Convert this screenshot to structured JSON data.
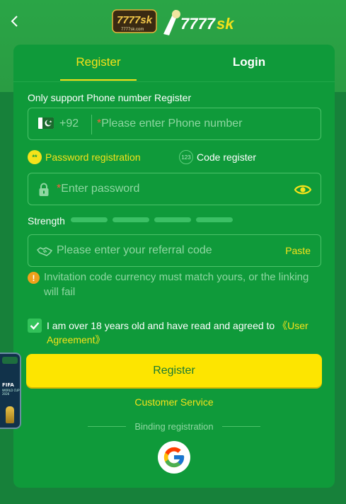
{
  "header": {
    "logo_text": "7777sk",
    "logo_subtext": "7777sk.com"
  },
  "tabs": {
    "register": "Register",
    "login": "Login"
  },
  "form": {
    "support_note": "Only support Phone number Register",
    "country_code": "+92",
    "phone_placeholder": "Please enter Phone number",
    "required_mark": "*",
    "mode_password_icon": "**",
    "mode_password_label": "Password registration",
    "mode_code_icon": "123",
    "mode_code_label": "Code register",
    "password_placeholder": "Enter password",
    "strength_label": "Strength",
    "referral_placeholder": "Please enter your referral code",
    "paste_label": "Paste",
    "warning_icon": "!",
    "warning_text": "Invitation code currency must match yours, or the linking will fail",
    "agree_checked": true,
    "agree_text": "I am over 18 years old and have read and agreed to ",
    "agree_link": "《User Agreement》",
    "register_button": "Register",
    "customer_service": "Customer Service",
    "binding_label": "Binding registration"
  },
  "side_promo": {
    "title": "FIFA",
    "subtitle": "WORLD CUP 2026"
  },
  "icons": {
    "back": "chevron-left-icon",
    "flag": "pakistan-flag-icon",
    "lock": "lock-icon",
    "eye": "eye-icon",
    "referral": "handshake-icon",
    "check": "check-icon",
    "google": "google-icon"
  },
  "colors": {
    "accent": "#f5e21a",
    "card": "#0f9a3a",
    "button": "#fde500",
    "field_border": "#4cc36a",
    "placeholder": "#8fd7a2",
    "required": "#ff5a3c",
    "warning": "#f0a11b"
  }
}
